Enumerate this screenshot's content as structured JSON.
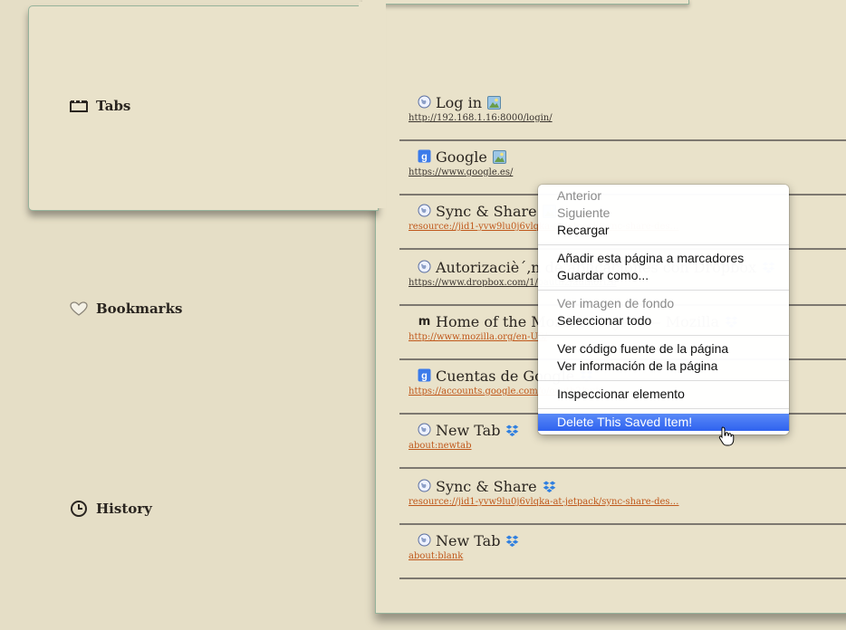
{
  "sidebar": {
    "tabs_label": "Tabs",
    "bookmarks_label": "Bookmarks",
    "history_label": "History"
  },
  "items": [
    {
      "title": "Log in",
      "url": "http://192.168.1.16:8000/login/",
      "favicon": "globe-icon",
      "badge": "device-icon",
      "url_color": "dark"
    },
    {
      "title": "Google",
      "url": "https://www.google.es/",
      "favicon": "google-icon",
      "badge": "device-icon",
      "url_color": "dark"
    },
    {
      "title": "Sync & Share",
      "url": "resource://jid1-yvw9lu0j6vlqka-at-jetpack/sync-share-des…",
      "favicon": "globe-icon",
      "badge": "device-icon",
      "url_color": "orange"
    },
    {
      "title": "Autorizaciè´‚n de aplicaciones con Dropbox",
      "url": "https://www.dropbox.com/1/oauth2/authorize",
      "favicon": "globe-icon",
      "badge": "dropbox-icon",
      "url_color": "dark"
    },
    {
      "title": "Home of the Mozilla Project — Mozilla",
      "url": "http://www.mozilla.org/en-US/",
      "favicon": "mozilla-icon",
      "badge": "dropbox-icon",
      "url_color": "orange"
    },
    {
      "title": "Cuentas de Google",
      "url": "https://accounts.google.com/o/oauth2/auth",
      "favicon": "google-icon",
      "badge": "dropbox-icon",
      "url_color": "orange"
    },
    {
      "title": "New Tab",
      "url": "about:newtab",
      "favicon": "globe-icon",
      "badge": "dropbox-icon",
      "url_color": "orange"
    },
    {
      "title": "Sync & Share",
      "url": "resource://jid1-yvw9lu0j6vlqka-at-jetpack/sync-share-des…",
      "favicon": "globe-icon",
      "badge": "dropbox-icon",
      "url_color": "orange"
    },
    {
      "title": "New Tab",
      "url": "about:blank",
      "favicon": "globe-icon",
      "badge": "dropbox-icon",
      "url_color": "orange"
    }
  ],
  "context_menu": {
    "back": "Anterior",
    "forward": "Siguiente",
    "reload": "Recargar",
    "bookmark_page": "Añadir esta página a marcadores",
    "save_as": "Guardar como...",
    "view_background": "Ver imagen de fondo",
    "select_all": "Seleccionar todo",
    "view_source": "Ver código fuente de la página",
    "page_info": "Ver información de la página",
    "inspect": "Inspeccionar elemento",
    "delete_saved": "Delete This Saved Item!"
  },
  "colors": {
    "background": "#e5dec6",
    "panel": "#e9e2ca",
    "panel_border": "#96b39b",
    "url_orange": "#c0581b",
    "menu_highlight": "#3a6ef2",
    "dropbox_blue": "#2f7fe0"
  }
}
